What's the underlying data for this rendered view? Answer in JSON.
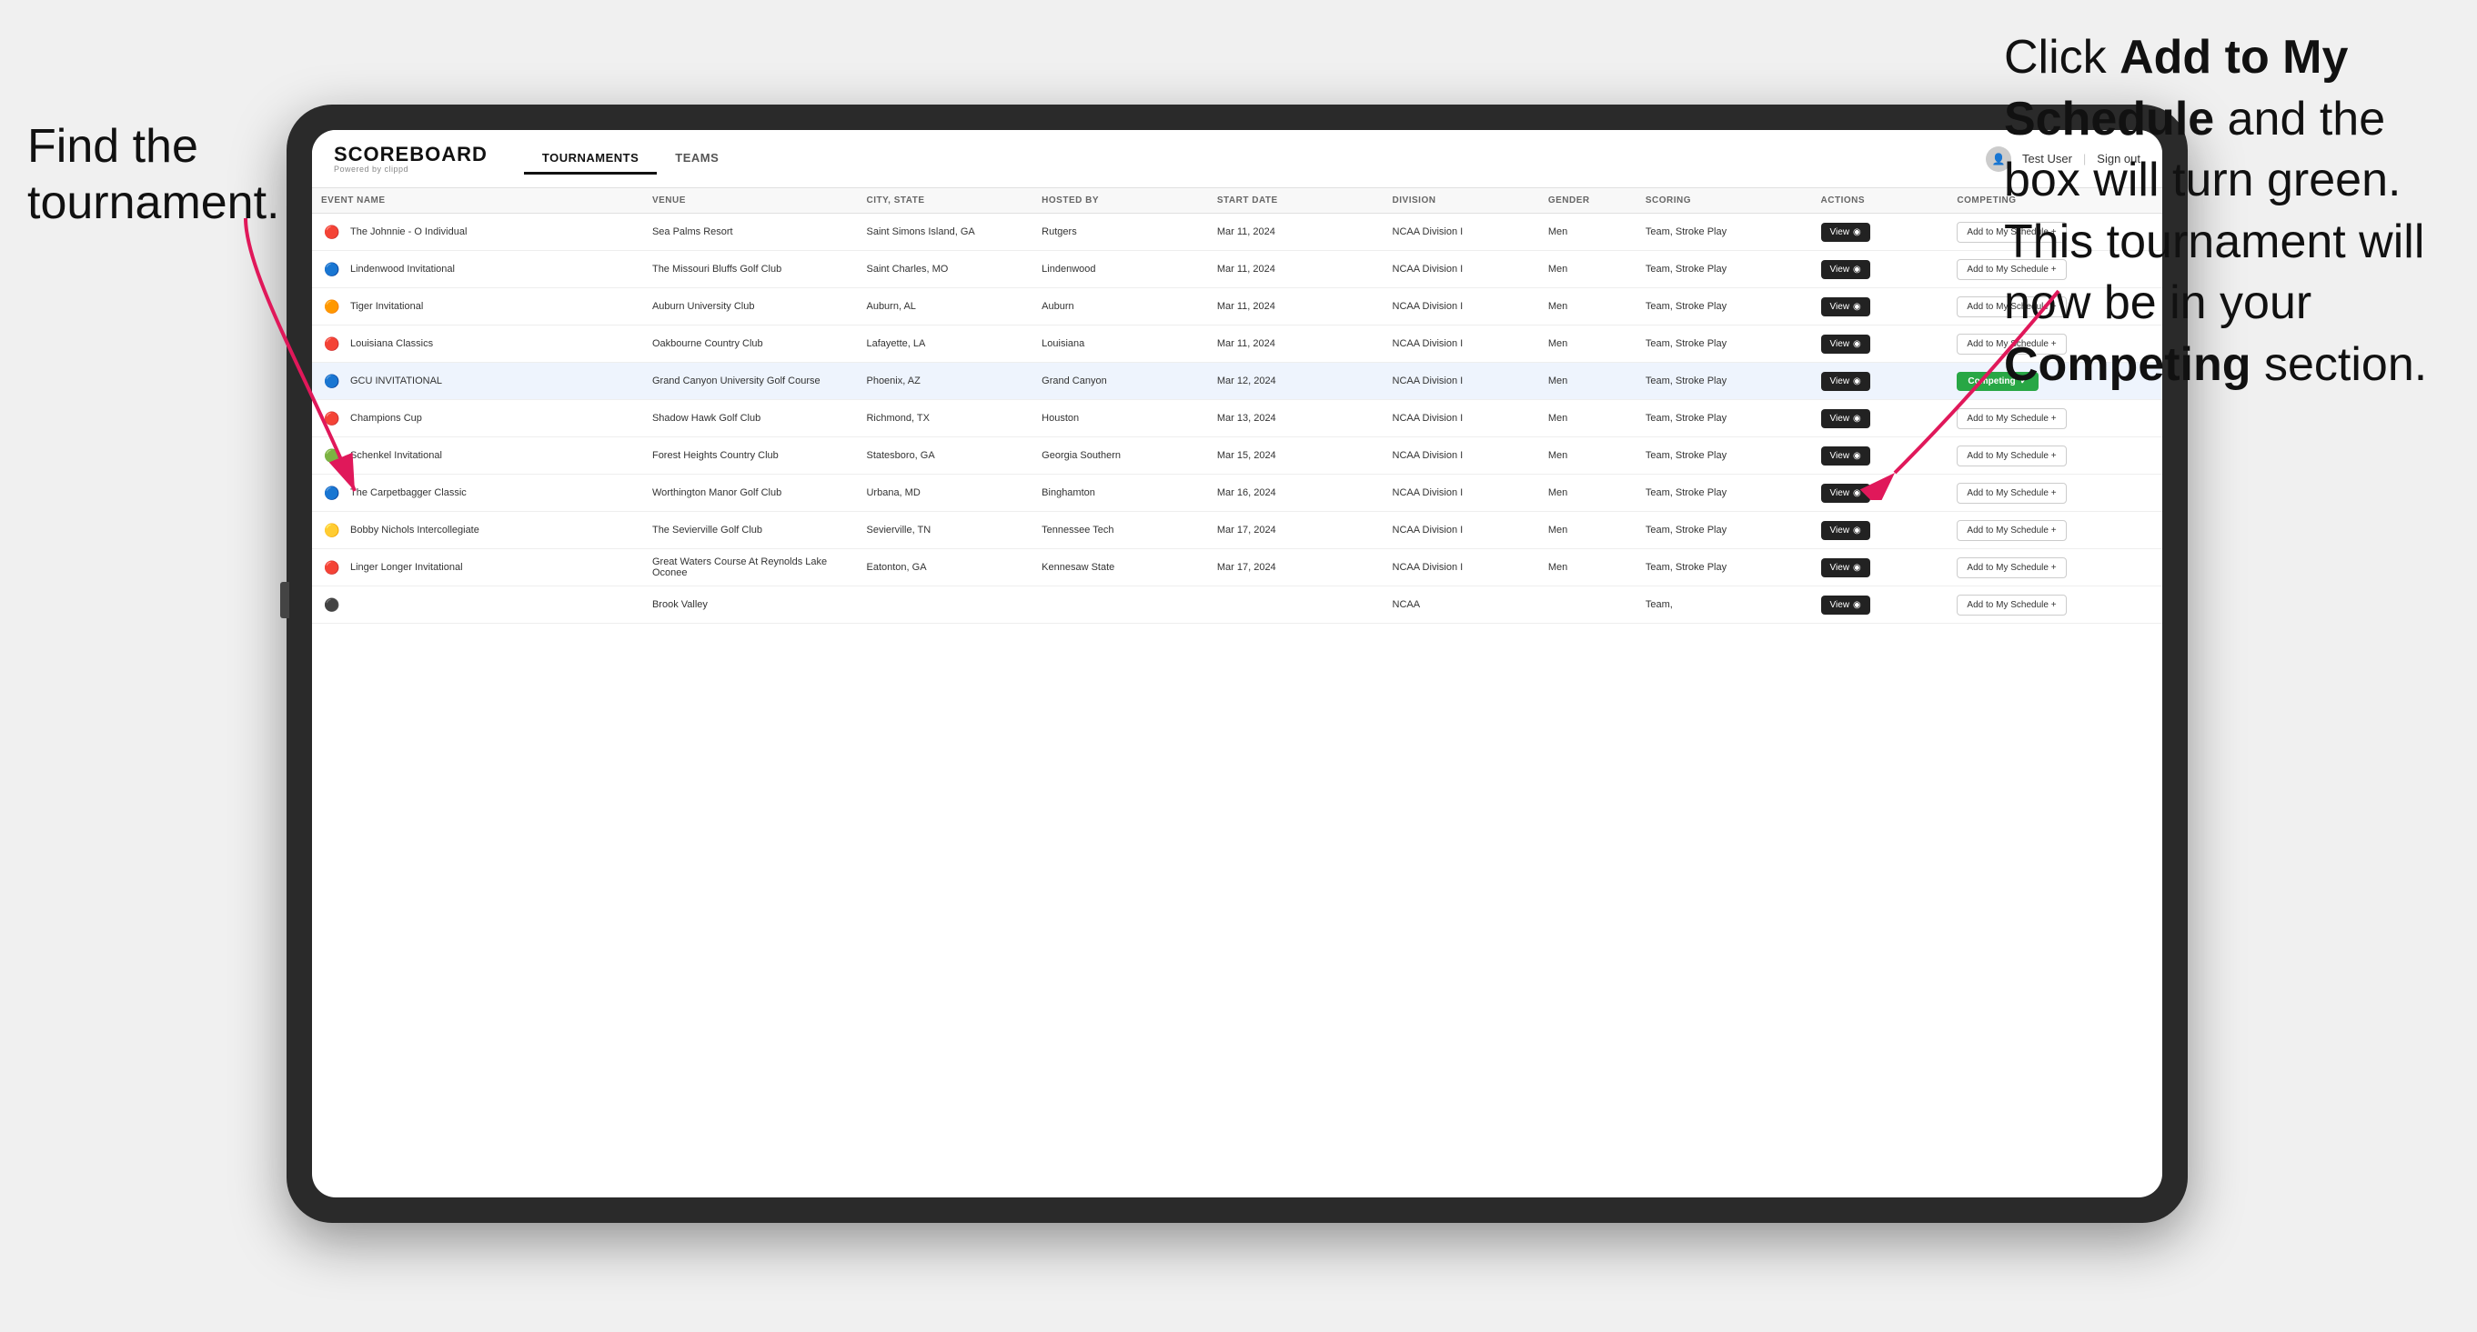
{
  "instructions": {
    "left": "Find the\ntournament.",
    "right_part1": "Click ",
    "right_bold1": "Add to My\nSchedule",
    "right_part2": " and the\nbox will turn green.\nThis tournament\nwill now be in\nyour ",
    "right_bold2": "Competing",
    "right_part3": "\nsection."
  },
  "nav": {
    "logo": "SCOREBOARD",
    "logo_sub": "Powered by clippd",
    "tabs": [
      "TOURNAMENTS",
      "TEAMS"
    ],
    "active_tab": 0,
    "user": "Test User",
    "sign_out": "Sign out"
  },
  "table": {
    "columns": [
      "EVENT NAME",
      "VENUE",
      "CITY, STATE",
      "HOSTED BY",
      "START DATE",
      "DIVISION",
      "GENDER",
      "SCORING",
      "ACTIONS",
      "COMPETING"
    ],
    "rows": [
      {
        "logo": "🔴",
        "name": "The Johnnie - O Individual",
        "venue": "Sea Palms Resort",
        "city": "Saint Simons Island, GA",
        "hosted": "Rutgers",
        "date": "Mar 11, 2024",
        "division": "NCAA Division I",
        "gender": "Men",
        "scoring": "Team, Stroke Play",
        "action": "View",
        "competing": "Add to My Schedule +",
        "competing_status": "add",
        "highlighted": false
      },
      {
        "logo": "🔵",
        "name": "Lindenwood Invitational",
        "venue": "The Missouri Bluffs Golf Club",
        "city": "Saint Charles, MO",
        "hosted": "Lindenwood",
        "date": "Mar 11, 2024",
        "division": "NCAA Division I",
        "gender": "Men",
        "scoring": "Team, Stroke Play",
        "action": "View",
        "competing": "Add to My Schedule +",
        "competing_status": "add",
        "highlighted": false
      },
      {
        "logo": "🟠",
        "name": "Tiger Invitational",
        "venue": "Auburn University Club",
        "city": "Auburn, AL",
        "hosted": "Auburn",
        "date": "Mar 11, 2024",
        "division": "NCAA Division I",
        "gender": "Men",
        "scoring": "Team, Stroke Play",
        "action": "View",
        "competing": "Add to My Schedule +",
        "competing_status": "add",
        "highlighted": false
      },
      {
        "logo": "🔴",
        "name": "Louisiana Classics",
        "venue": "Oakbourne Country Club",
        "city": "Lafayette, LA",
        "hosted": "Louisiana",
        "date": "Mar 11, 2024",
        "division": "NCAA Division I",
        "gender": "Men",
        "scoring": "Team, Stroke Play",
        "action": "View",
        "competing": "Add to My Schedule +",
        "competing_status": "add",
        "highlighted": false
      },
      {
        "logo": "🔵",
        "name": "GCU INVITATIONAL",
        "venue": "Grand Canyon University Golf Course",
        "city": "Phoenix, AZ",
        "hosted": "Grand Canyon",
        "date": "Mar 12, 2024",
        "division": "NCAA Division I",
        "gender": "Men",
        "scoring": "Team, Stroke Play",
        "action": "View",
        "competing": "Competing ✓",
        "competing_status": "competing",
        "highlighted": true
      },
      {
        "logo": "🔴",
        "name": "Champions Cup",
        "venue": "Shadow Hawk Golf Club",
        "city": "Richmond, TX",
        "hosted": "Houston",
        "date": "Mar 13, 2024",
        "division": "NCAA Division I",
        "gender": "Men",
        "scoring": "Team, Stroke Play",
        "action": "View",
        "competing": "Add to My Schedule +",
        "competing_status": "add",
        "highlighted": false
      },
      {
        "logo": "🟢",
        "name": "Schenkel Invitational",
        "venue": "Forest Heights Country Club",
        "city": "Statesboro, GA",
        "hosted": "Georgia Southern",
        "date": "Mar 15, 2024",
        "division": "NCAA Division I",
        "gender": "Men",
        "scoring": "Team, Stroke Play",
        "action": "View",
        "competing": "Add to My Schedule +",
        "competing_status": "add",
        "highlighted": false
      },
      {
        "logo": "🔵",
        "name": "The Carpetbagger Classic",
        "venue": "Worthington Manor Golf Club",
        "city": "Urbana, MD",
        "hosted": "Binghamton",
        "date": "Mar 16, 2024",
        "division": "NCAA Division I",
        "gender": "Men",
        "scoring": "Team, Stroke Play",
        "action": "View",
        "competing": "Add to My Schedule +",
        "competing_status": "add",
        "highlighted": false
      },
      {
        "logo": "🟡",
        "name": "Bobby Nichols Intercollegiate",
        "venue": "The Sevierville Golf Club",
        "city": "Sevierville, TN",
        "hosted": "Tennessee Tech",
        "date": "Mar 17, 2024",
        "division": "NCAA Division I",
        "gender": "Men",
        "scoring": "Team, Stroke Play",
        "action": "View",
        "competing": "Add to My Schedule +",
        "competing_status": "add",
        "highlighted": false
      },
      {
        "logo": "🔴",
        "name": "Linger Longer Invitational",
        "venue": "Great Waters Course At Reynolds Lake Oconee",
        "city": "Eatonton, GA",
        "hosted": "Kennesaw State",
        "date": "Mar 17, 2024",
        "division": "NCAA Division I",
        "gender": "Men",
        "scoring": "Team, Stroke Play",
        "action": "View",
        "competing": "Add to My Schedule +",
        "competing_status": "add",
        "highlighted": false
      },
      {
        "logo": "⚫",
        "name": "",
        "venue": "Brook Valley",
        "city": "",
        "hosted": "",
        "date": "",
        "division": "NCAA",
        "gender": "",
        "scoring": "Team,",
        "action": "View",
        "competing": "Add to My Schedule +",
        "competing_status": "add",
        "highlighted": false
      }
    ]
  }
}
